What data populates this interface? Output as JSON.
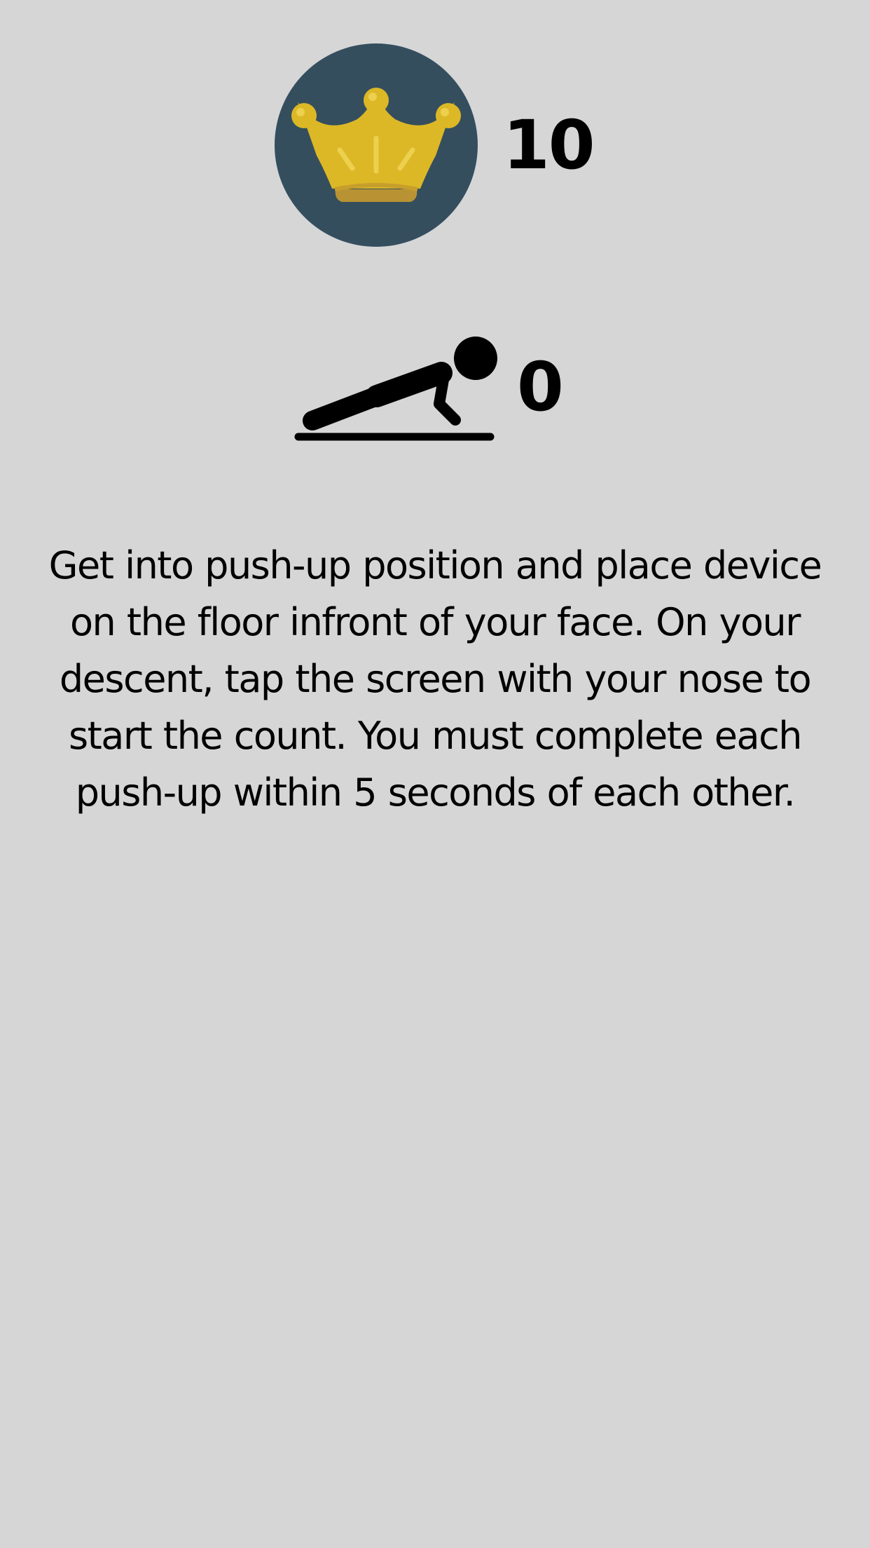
{
  "best_score": {
    "icon": "crown-icon",
    "value": "10",
    "badge_color": "#344e5e",
    "crown_color": "#dcb826"
  },
  "current_count": {
    "icon": "pushup-icon",
    "value": "0"
  },
  "instructions": {
    "text": "Get into push-up position and place device on the floor infront of your face. On your descent, tap the screen with your nose to start the count. You must complete each push-up within 5 seconds of each other."
  },
  "background_color": "#d6d6d7"
}
